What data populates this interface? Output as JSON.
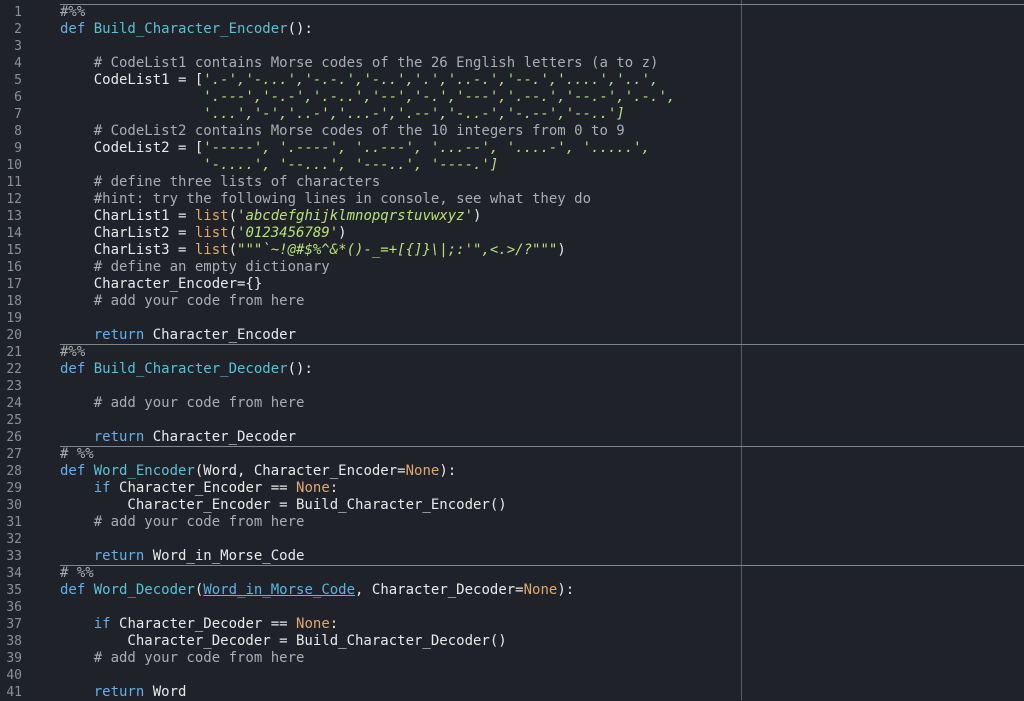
{
  "gutter": {
    "line_numbers": [
      "1",
      "2",
      "3",
      "4",
      "5",
      "6",
      "7",
      "8",
      "9",
      "10",
      "11",
      "12",
      "13",
      "14",
      "15",
      "16",
      "17",
      "18",
      "19",
      "20",
      "21",
      "22",
      "23",
      "24",
      "25",
      "26",
      "27",
      "28",
      "29",
      "30",
      "31",
      "32",
      "33",
      "34",
      "35",
      "36",
      "37",
      "38",
      "39",
      "40",
      "41"
    ]
  },
  "code": {
    "l1": "#%%",
    "l2_kw": "def ",
    "l2_fn": "Build_Character_Encoder",
    "l2_rest": "():",
    "l4": "    # CodeList1 contains Morse codes of the 26 English letters (a to z)",
    "l5_a": "    CodeList1 = [",
    "l5_s": "'.-','-...','-.-.','-..','.','..-.','--.','....','..',",
    "l6_s": "                 '.---','-.-','.-..','--','-.','---','.--.','--.-','.-.',",
    "l7_s": "                 '...','-','..-','...-','.--','-..-','-.--','--..']",
    "l8": "    # CodeList2 contains Morse codes of the 10 integers from 0 to 9",
    "l9_a": "    CodeList2 = [",
    "l9_s": "'-----', '.----', '..---', '...--', '....-', '.....',",
    "l10_s": "                 '-....', '--...', '---..', '----.']",
    "l11": "    # define three lists of characters",
    "l12": "    #hint: try the following lines in console, see what they do",
    "l13_a": "    CharList1 = ",
    "l13_b": "list",
    "l13_c": "(",
    "l13_s": "'abcdefghijklmnopqrstuvwxyz'",
    "l13_d": ")",
    "l14_a": "    CharList2 = ",
    "l14_b": "list",
    "l14_c": "(",
    "l14_s": "'0123456789'",
    "l14_d": ")",
    "l15_a": "    CharList3 = ",
    "l15_b": "list",
    "l15_c": "(",
    "l15_s": "\"\"\"`~!@#$%^&*()-_=+[{]}\\|;:'\",<.>/?\"\"\"",
    "l15_d": ")",
    "l16": "    # define an empty dictionary",
    "l17": "    Character_Encoder={}",
    "l18": "    # add your code from here",
    "l20_kw": "    return ",
    "l20_rest": "Character_Encoder",
    "l21": "#%%",
    "l22_kw": "def ",
    "l22_fn": "Build_Character_Decoder",
    "l22_rest": "():",
    "l24": "    # add your code from here",
    "l26_kw": "    return ",
    "l26_rest": "Character_Decoder",
    "l27": "# %%",
    "l28_kw": "def ",
    "l28_fn": "Word_Encoder",
    "l28_a": "(Word, Character_Encoder=",
    "l28_none": "None",
    "l28_b": "):",
    "l29_kw": "    if ",
    "l29_a": "Character_Encoder == ",
    "l29_none": "None",
    "l29_b": ":",
    "l30": "        Character_Encoder = Build_Character_Encoder()",
    "l31": "    # add your code from here",
    "l33_kw": "    return ",
    "l33_rest": "Word_in_Morse_Code",
    "l34": "# %%",
    "l35_kw": "def ",
    "l35_fn": "Word_Decoder",
    "l35_a": "(",
    "l35_link": "Word_in_Morse_Code",
    "l35_b": ", Character_Decoder=",
    "l35_none": "None",
    "l35_c": "):",
    "l37_kw": "    if ",
    "l37_a": "Character_Decoder == ",
    "l37_none": "None",
    "l37_b": ":",
    "l38": "        Character_Decoder = Build_Character_Decoder()",
    "l39": "    # add your code from here",
    "l41_kw": "    return ",
    "l41_rest": "Word"
  },
  "colors": {
    "background": "#1f2329",
    "comment": "#a9adb3",
    "keyword": "#61afef",
    "function": "#56c2d6",
    "string": "#b7e07a",
    "none_builtin": "#e0a86c"
  }
}
